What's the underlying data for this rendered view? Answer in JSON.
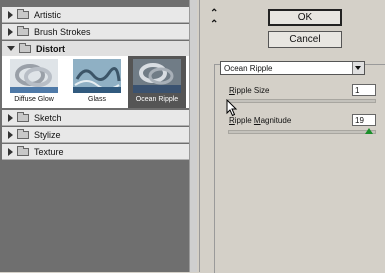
{
  "gallery": {
    "categories_top": [
      {
        "label": "Artistic"
      },
      {
        "label": "Brush Strokes"
      }
    ],
    "open_category": {
      "label": "Distort"
    },
    "thumbnails": [
      {
        "label": "Diffuse Glow"
      },
      {
        "label": "Glass"
      },
      {
        "label": "Ocean Ripple",
        "selected": true
      }
    ],
    "categories_bottom": [
      {
        "label": "Sketch"
      },
      {
        "label": "Stylize"
      },
      {
        "label": "Texture"
      }
    ]
  },
  "buttons": {
    "ok": "OK",
    "cancel": "Cancel"
  },
  "filter_select": {
    "value": "Ocean Ripple"
  },
  "params": {
    "ripple_size": {
      "label_u": "R",
      "label_rest": "ipple Size",
      "value": "1"
    },
    "ripple_magnitude": {
      "label_u1": "R",
      "label_mid": "ipple ",
      "label_u2": "M",
      "label_rest": "agnitude",
      "value": "19",
      "fraction": 0.95
    }
  },
  "icons": [
    "chevron-right-icon",
    "chevron-down-icon",
    "folder-icon",
    "collapse-chevrons-icon",
    "dropdown-arrow-icon",
    "slider-knob-icon",
    "mouse-cursor-icon"
  ]
}
